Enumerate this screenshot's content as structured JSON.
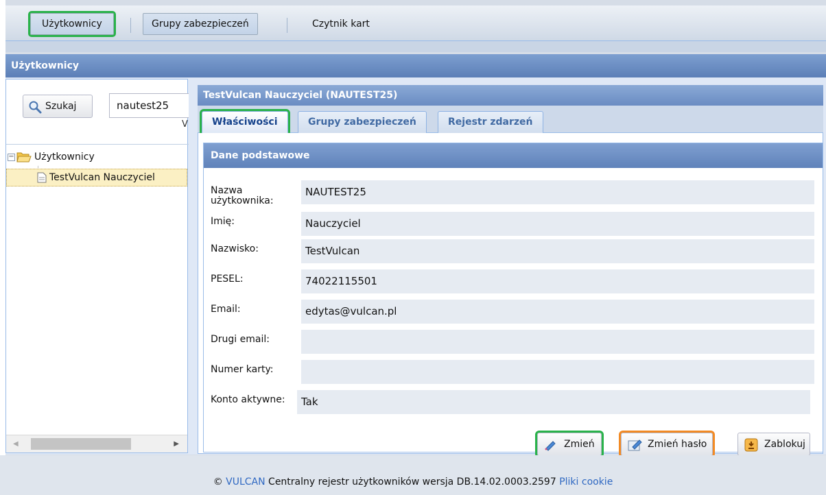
{
  "toolbar": {
    "items": [
      {
        "label": "Użytkownicy"
      },
      {
        "label": "Grupy zabezpieczeń"
      },
      {
        "label": "Czytnik kart"
      }
    ]
  },
  "panel": {
    "title": "Użytkownicy"
  },
  "search": {
    "button_label": "Szukaj",
    "value": "nautest25",
    "overflow_char": "V"
  },
  "tree": {
    "root_label": "Użytkownicy",
    "selected_item": "TestVulcan Nauczyciel"
  },
  "detail": {
    "title": "TestVulcan Nauczyciel (NAUTEST25)",
    "tabs": [
      {
        "label": "Właściwości"
      },
      {
        "label": "Grupy zabezpieczeń"
      },
      {
        "label": "Rejestr zdarzeń"
      }
    ],
    "section_title": "Dane podstawowe",
    "fields": [
      {
        "label": "Nazwa użytkownika:",
        "value": "NAUTEST25"
      },
      {
        "label": "Imię:",
        "value": "Nauczyciel"
      },
      {
        "label": "Nazwisko:",
        "value": "TestVulcan"
      },
      {
        "label": "PESEL:",
        "value": "74022115501"
      },
      {
        "label": "Email:",
        "value": "edytas@vulcan.pl"
      },
      {
        "label": "Drugi email:",
        "value": ""
      },
      {
        "label": "Numer karty:",
        "value": ""
      },
      {
        "label": "Konto aktywne:",
        "value": "Tak"
      }
    ],
    "buttons": {
      "change": "Zmień",
      "change_password": "Zmień hasło",
      "lock": "Zablokuj"
    }
  },
  "footer": {
    "copyright": "©",
    "brand": "VULCAN",
    "text": "Centralny rejestr użytkowników wersja DB.14.02.0003.2597",
    "cookie_link": "Pliki cookie"
  },
  "colors": {
    "highlight_green": "#29b24a",
    "highlight_orange": "#f28a24",
    "header_blue": "#5c7fb7"
  }
}
